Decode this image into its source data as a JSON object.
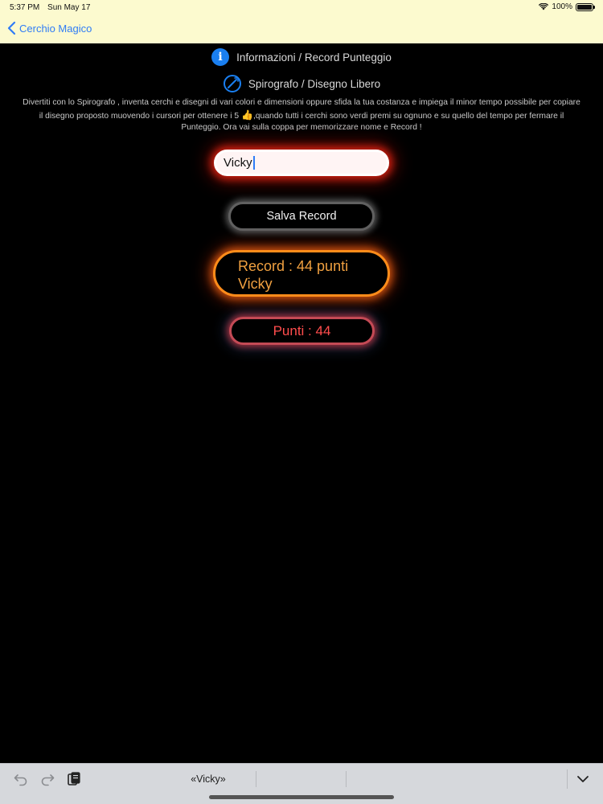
{
  "status_bar": {
    "time": "5:37 PM",
    "date": "Sun May 17",
    "battery": "100%",
    "icons": [
      "wifi-icon",
      "battery-icon"
    ]
  },
  "nav": {
    "back_label": "Cerchio Magico",
    "back_icon": "chevron-left-icon",
    "accent_color": "#2f7cf6"
  },
  "menu": {
    "info_label": "Informazioni / Record Punteggio",
    "info_icon": "info-icon",
    "spiro_label": "Spirografo / Disegno Libero",
    "spiro_icon": "spirograph-icon"
  },
  "description": {
    "line1": "Divertiti con lo Spirografo , inventa cerchi e disegni di vari colori e dimensioni oppure sfida la tua costanza e impiega il minor tempo possibile per copiare",
    "line2_before": "il disegno proposto muovendo i cursori per ottenere i 5 ",
    "thumb": "👍",
    "line2_after": ",quando tutti i cerchi sono verdi premi su ognuno e su quello del tempo per fermare il",
    "line3": "Punteggio. Ora vai sulla coppa per memorizzare nome e Record !"
  },
  "form": {
    "name_value": "Vicky",
    "save_label": "Salva Record",
    "record_line1": "Record : 44 punti",
    "record_line2": "Vicky",
    "points_label": "Punti : 44"
  },
  "keyboard_bar": {
    "suggestions": [
      "«Vicky»",
      "",
      ""
    ],
    "icons": [
      "undo-icon",
      "redo-icon",
      "paste-icon",
      "keyboard-dismiss-icon"
    ]
  }
}
